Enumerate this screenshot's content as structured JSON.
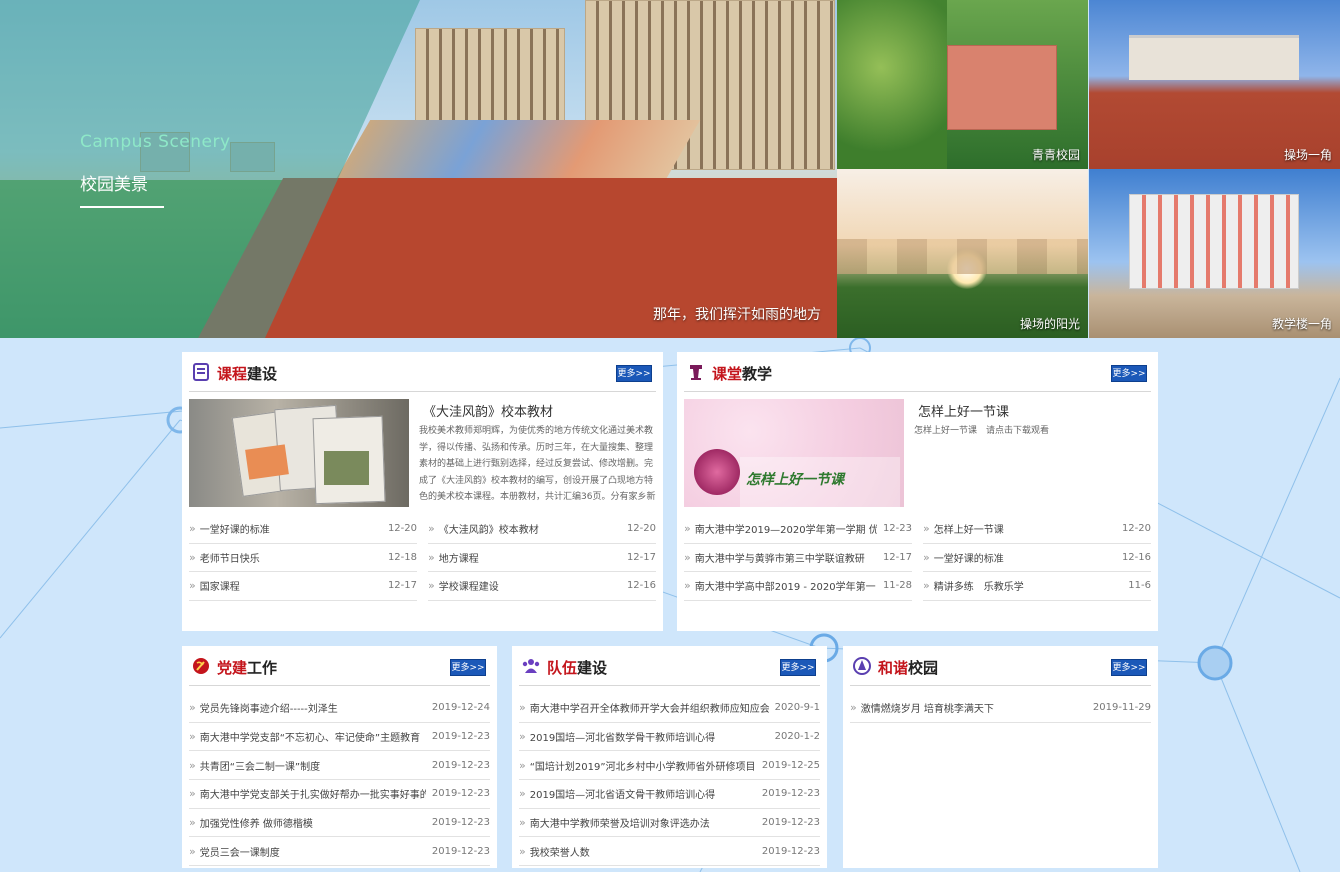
{
  "hero": {
    "en_title": "Campus Scenery",
    "cn_title": "校园美景",
    "caption": "那年，我们挥汗如雨的地方"
  },
  "thumbs": [
    {
      "caption": "青青校园"
    },
    {
      "caption": "操场一角"
    },
    {
      "caption": "操场的阳光"
    },
    {
      "caption": "教学楼一角"
    }
  ],
  "more_label": "更多>>",
  "arrow": "»",
  "kecheng": {
    "title_hl": "课程",
    "title_rest": "建设",
    "feature_title": "《大洼风韵》校本教材",
    "feature_desc": "我校美术教师郑明辉，为使优秀的地方传统文化通过美术教学，得以传播、弘扬和传承。历时三年，在大量搜集、整理素材的基础上进行甄别选择，经过反复尝试、修改增删。完成了《大洼风韵》校本教材的编写，创设开展了凸现地方特色的美术校本课程。本册教材，共计汇编36页。分有家乡新景、苇荡湿地、欢",
    "left": [
      {
        "text": "一堂好课的标准",
        "date": "12-20"
      },
      {
        "text": "老师节日快乐",
        "date": "12-18"
      },
      {
        "text": "国家课程",
        "date": "12-17"
      }
    ],
    "right": [
      {
        "text": "《大洼风韵》校本教材",
        "date": "12-20"
      },
      {
        "text": "地方课程",
        "date": "12-17"
      },
      {
        "text": "学校课程建设",
        "date": "12-16"
      }
    ]
  },
  "ketang": {
    "title_hl": "课堂",
    "title_rest": "教学",
    "feature_title": "怎样上好一节课",
    "feature_desc": "怎样上好一节课　请点击下载观看",
    "img_text": "怎样上好一节课",
    "left": [
      {
        "text": "南大港中学2019—2020学年第一学期 优",
        "date": "12-23"
      },
      {
        "text": "南大港中学与黄骅市第三中学联谊教研",
        "date": "12-17"
      },
      {
        "text": "南大港中学高中部2019 - 2020学年第一",
        "date": "11-28"
      }
    ],
    "right": [
      {
        "text": "怎样上好一节课",
        "date": "12-20"
      },
      {
        "text": "一堂好课的标准",
        "date": "12-16"
      },
      {
        "text": "精讲多练　乐教乐学",
        "date": "11-6"
      }
    ]
  },
  "dangjian": {
    "title_hl": "党建",
    "title_rest": "工作",
    "items": [
      {
        "text": "党员先锋岗事迹介绍-----刘泽生",
        "date": "2019-12-24"
      },
      {
        "text": "南大港中学党支部“不忘初心、牢记使命”主题教育",
        "date": "2019-12-23"
      },
      {
        "text": "共青团“三会二制一课”制度",
        "date": "2019-12-23"
      },
      {
        "text": "南大港中学党支部关于扎实做好帮办一批实事好事的",
        "date": "2019-12-23"
      },
      {
        "text": "加强党性修养 做师德楷模",
        "date": "2019-12-23"
      },
      {
        "text": "党员三会一课制度",
        "date": "2019-12-23"
      }
    ]
  },
  "duiwu": {
    "title_hl": "队伍",
    "title_rest": "建设",
    "items": [
      {
        "text": "南大港中学召开全体教师开学大会并组织教师应知应会",
        "date": "2020-9-1"
      },
      {
        "text": "2019国培—河北省数学骨干教师培训心得",
        "date": "2020-1-2"
      },
      {
        "text": "“国培计划2019”河北乡村中小学教师省外研修项目",
        "date": "2019-12-25"
      },
      {
        "text": "2019国培—河北省语文骨干教师培训心得",
        "date": "2019-12-23"
      },
      {
        "text": "南大港中学教师荣誉及培训对象评选办法",
        "date": "2019-12-23"
      },
      {
        "text": "我校荣誉人数",
        "date": "2019-12-23"
      }
    ]
  },
  "hexie": {
    "title_hl": "和谐",
    "title_rest": "校园",
    "items": [
      {
        "text": "激情燃烧岁月 培育桃李满天下",
        "date": "2019-11-29"
      }
    ]
  },
  "colors": {
    "accent_red": "#c4151c",
    "more_blue": "#1b58b8",
    "page_bg": "#cfe6fb"
  }
}
